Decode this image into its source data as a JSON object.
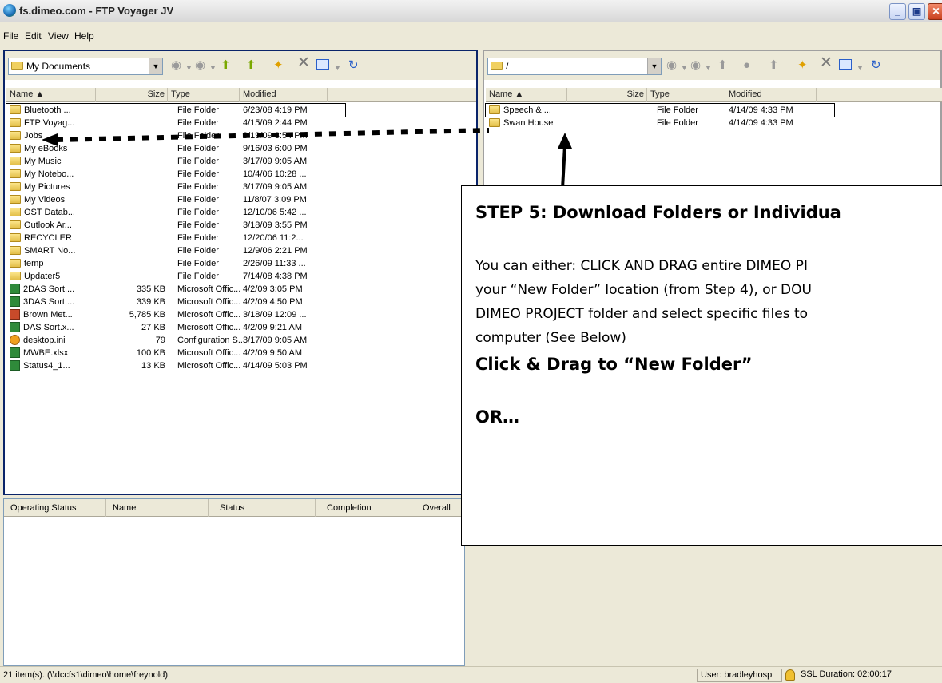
{
  "window": {
    "title": "fs.dimeo.com - FTP Voyager JV"
  },
  "menu": [
    "File",
    "Edit",
    "View",
    "Help"
  ],
  "left": {
    "address": "My Documents",
    "columns": [
      "Name ▲",
      "Size",
      "Type",
      "Modified"
    ],
    "rows": [
      {
        "name": "Bluetooth ...",
        "size": "",
        "type": "File Folder",
        "modified": "6/23/08 4:19 PM",
        "icon": "folder"
      },
      {
        "name": "FTP Voyag...",
        "size": "",
        "type": "File Folder",
        "modified": "4/15/09 2:44 PM",
        "icon": "folder"
      },
      {
        "name": "Jobs",
        "size": "",
        "type": "File Folder",
        "modified": "3/19/09 3:54 PM",
        "icon": "folder"
      },
      {
        "name": "My eBooks",
        "size": "",
        "type": "File Folder",
        "modified": "9/16/03 6:00 PM",
        "icon": "folder"
      },
      {
        "name": "My Music",
        "size": "",
        "type": "File Folder",
        "modified": "3/17/09 9:05 AM",
        "icon": "folder"
      },
      {
        "name": "My Notebo...",
        "size": "",
        "type": "File Folder",
        "modified": "10/4/06 10:28 ...",
        "icon": "folder"
      },
      {
        "name": "My Pictures",
        "size": "",
        "type": "File Folder",
        "modified": "3/17/09 9:05 AM",
        "icon": "folder"
      },
      {
        "name": "My Videos",
        "size": "",
        "type": "File Folder",
        "modified": "11/8/07 3:09 PM",
        "icon": "folder"
      },
      {
        "name": "OST Datab...",
        "size": "",
        "type": "File Folder",
        "modified": "12/10/06 5:42 ...",
        "icon": "folder"
      },
      {
        "name": "Outlook Ar...",
        "size": "",
        "type": "File Folder",
        "modified": "3/18/09 3:55 PM",
        "icon": "folder"
      },
      {
        "name": "RECYCLER",
        "size": "",
        "type": "File Folder",
        "modified": "12/20/06 11:2...",
        "icon": "folder"
      },
      {
        "name": "SMART No...",
        "size": "",
        "type": "File Folder",
        "modified": "12/9/06 2:21 PM",
        "icon": "folder"
      },
      {
        "name": "temp",
        "size": "",
        "type": "File Folder",
        "modified": "2/26/09 11:33 ...",
        "icon": "folder"
      },
      {
        "name": "Updater5",
        "size": "",
        "type": "File Folder",
        "modified": "7/14/08 4:38 PM",
        "icon": "folder"
      },
      {
        "name": "2DAS Sort....",
        "size": "335 KB",
        "type": "Microsoft Offic...",
        "modified": "4/2/09 3:05 PM",
        "icon": "excel"
      },
      {
        "name": "3DAS Sort....",
        "size": "339 KB",
        "type": "Microsoft Offic...",
        "modified": "4/2/09 4:50 PM",
        "icon": "excel"
      },
      {
        "name": "Brown Met...",
        "size": "5,785 KB",
        "type": "Microsoft Offic...",
        "modified": "3/18/09 12:09 ...",
        "icon": "ppt"
      },
      {
        "name": "DAS Sort.x...",
        "size": "27 KB",
        "type": "Microsoft Offic...",
        "modified": "4/2/09 9:21 AM",
        "icon": "excel"
      },
      {
        "name": "desktop.ini",
        "size": "79",
        "type": "Configuration S...",
        "modified": "3/17/09 9:05 AM",
        "icon": "ini"
      },
      {
        "name": "MWBE.xlsx",
        "size": "100 KB",
        "type": "Microsoft Offic...",
        "modified": "4/2/09 9:50 AM",
        "icon": "excel"
      },
      {
        "name": "Status4_1...",
        "size": "13 KB",
        "type": "Microsoft Offic...",
        "modified": "4/14/09 5:03 PM",
        "icon": "excel"
      }
    ]
  },
  "right": {
    "address": "/",
    "columns": [
      "Name ▲",
      "Size",
      "Type",
      "Modified"
    ],
    "rows": [
      {
        "name": "Speech & ...",
        "size": "",
        "type": "File Folder",
        "modified": "4/14/09 4:33 PM",
        "icon": "folder"
      },
      {
        "name": "Swan House",
        "size": "",
        "type": "File Folder",
        "modified": "4/14/09 4:33 PM",
        "icon": "folder"
      }
    ]
  },
  "queue": {
    "columns": [
      "Operating Status",
      "Name",
      "Status",
      "Completion",
      "Overall"
    ]
  },
  "status": {
    "left": "21 item(s).  (\\\\dccfs1\\dimeo\\home\\freynold)",
    "user": "User: bradleyhosp",
    "ssl": "SSL Duration:  02:00:17"
  },
  "callout": {
    "heading": "STEP 5: Download Folders or Individua",
    "body_lines": [
      "You can either: CLICK AND DRAG entire DIMEO PI",
      "your “New Folder” location (from Step 4), or DOU",
      "DIMEO PROJECT folder and select specific files to",
      "computer (See Below)"
    ],
    "sub1": "Click & Drag to “New Folder”",
    "sub2": "OR…"
  }
}
